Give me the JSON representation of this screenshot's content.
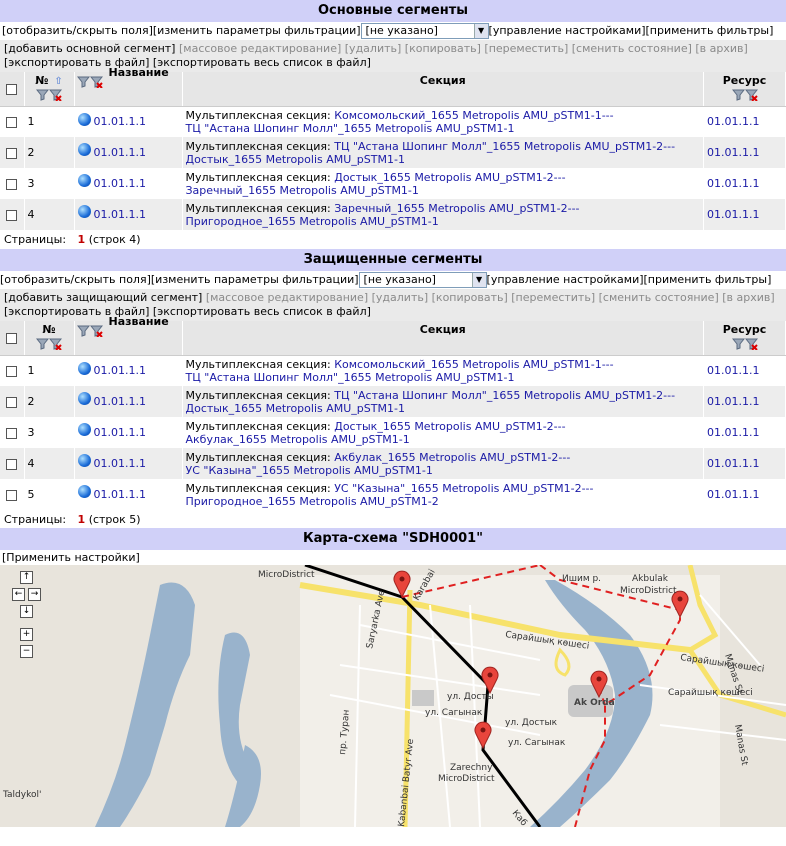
{
  "toolbar": {
    "show_hide_fields": "[отобразить/скрыть поля]",
    "change_filter": "[изменить параметры фильтрации]",
    "select_value": "[не указано]",
    "manage_settings": "[управление настройками]",
    "apply_filters": "[применить фильтры]"
  },
  "actions_common": {
    "mass_edit": "[массовое редактирование]",
    "delete": "[удалить]",
    "copy": "[копировать]",
    "move": "[переместить]",
    "change_state": "[сменить состояние]",
    "archive": "[в архив]",
    "export_file": "[экспортировать в файл]",
    "export_all": "[экспортировать весь список в файл]"
  },
  "columns": {
    "num": "№",
    "name": "Название",
    "section": "Секция",
    "resource": "Ресурс"
  },
  "pager_label": "Страницы:",
  "main_segments": {
    "title": "Основные сегменты",
    "add_label": "[добавить основной сегмент]",
    "current_page": "1",
    "rows_count": "(строк 4)",
    "rows": [
      {
        "num": "1",
        "name": "01.01.1.1",
        "prefix": "Мультиплексная секция: ",
        "line1": "Комсомольский_1655 Metropolis AMU_pSTM1-1---",
        "line2": "ТЦ \"Астана Шопинг Молл\"_1655 Metropolis AMU_pSTM1-1",
        "resource": "01.01.1.1"
      },
      {
        "num": "2",
        "name": "01.01.1.1",
        "prefix": "Мультиплексная секция: ",
        "line1": "ТЦ \"Астана Шопинг Молл\"_1655 Metropolis AMU_pSTM1-2---",
        "line2": "Достык_1655 Metropolis AMU_pSTM1-1",
        "resource": "01.01.1.1"
      },
      {
        "num": "3",
        "name": "01.01.1.1",
        "prefix": "Мультиплексная секция: ",
        "line1": "Достык_1655 Metropolis AMU_pSTM1-2---",
        "line2": "Заречный_1655 Metropolis AMU_pSTM1-1",
        "resource": "01.01.1.1"
      },
      {
        "num": "4",
        "name": "01.01.1.1",
        "prefix": "Мультиплексная секция: ",
        "line1": "Заречный_1655 Metropolis AMU_pSTM1-2---",
        "line2": "Пригородное_1655 Metropolis AMU_pSTM1-1",
        "resource": "01.01.1.1"
      }
    ]
  },
  "protected_segments": {
    "title": "Защищенные сегменты",
    "add_label": "[добавить защищающий сегмент]",
    "current_page": "1",
    "rows_count": "(строк 5)",
    "rows": [
      {
        "num": "1",
        "name": "01.01.1.1",
        "prefix": "Мультиплексная секция: ",
        "line1": "Комсомольский_1655 Metropolis AMU_pSTM1-1---",
        "line2": "ТЦ \"Астана Шопинг Молл\"_1655 Metropolis AMU_pSTM1-1",
        "resource": "01.01.1.1"
      },
      {
        "num": "2",
        "name": "01.01.1.1",
        "prefix": "Мультиплексная секция: ",
        "line1": "ТЦ \"Астана Шопинг Молл\"_1655 Metropolis AMU_pSTM1-2---",
        "line2": "Достык_1655 Metropolis AMU_pSTM1-1",
        "resource": "01.01.1.1"
      },
      {
        "num": "3",
        "name": "01.01.1.1",
        "prefix": "Мультиплексная секция: ",
        "line1": "Достык_1655 Metropolis AMU_pSTM1-2---",
        "line2": "Акбулак_1655 Metropolis AMU_pSTM1-1",
        "resource": "01.01.1.1"
      },
      {
        "num": "4",
        "name": "01.01.1.1",
        "prefix": "Мультиплексная секция: ",
        "line1": "Акбулак_1655 Metropolis AMU_pSTM1-2---",
        "line2": "УС \"Казына\"_1655 Metropolis AMU_pSTM1-1",
        "resource": "01.01.1.1"
      },
      {
        "num": "5",
        "name": "01.01.1.1",
        "prefix": "Мультиплексная секция: ",
        "line1": "УС \"Казына\"_1655 Metropolis AMU_pSTM1-2---",
        "line2": "Пригородное_1655 Metropolis AMU_pSTM1-2",
        "resource": "01.01.1.1"
      }
    ]
  },
  "map": {
    "title": "Карта-схема \"SDH0001\"",
    "apply_settings": "[Применить настройки]",
    "labels": {
      "microdistrict": "MicroDistrict",
      "ishim": "Ишим р.",
      "akbulak": "Akbulak",
      "akbulak_md": "MicroDistrict",
      "karabai": "Karabai",
      "saryarka": "Saryarka Ave",
      "saraishyk": "Сарайшық көшесі",
      "saraishyk2": "Сарайшық көшесі",
      "manas": "Manas St",
      "manas2": "Manas St",
      "dostyk": "ул. Досты",
      "dostyk2": "ул. Достык",
      "sagynak": "ул. Сагынак",
      "sagynak2": "ул. Сагынак",
      "turan": "пр. Туран",
      "akorda": "Ak Orda",
      "zarechny": "Zarechny",
      "zarechny2": "MicroDistrict",
      "kabanbai": "Kabanbai Batyr Ave",
      "kab2": "Каб",
      "taldykol": "Taldykol'"
    }
  },
  "colors": {
    "header_bg": "#d0d0f8",
    "link": "#1a1aa6",
    "pager_current": "#c00000",
    "route_main": "#000000",
    "route_protect": "#e02020",
    "marker": "#e8453c"
  },
  "icons": {
    "filter": "funnel-icon",
    "filter_clear": "funnel-clear-icon",
    "sort": "sort-arrow-icon",
    "globe": "globe-icon",
    "marker": "map-pin-icon"
  }
}
